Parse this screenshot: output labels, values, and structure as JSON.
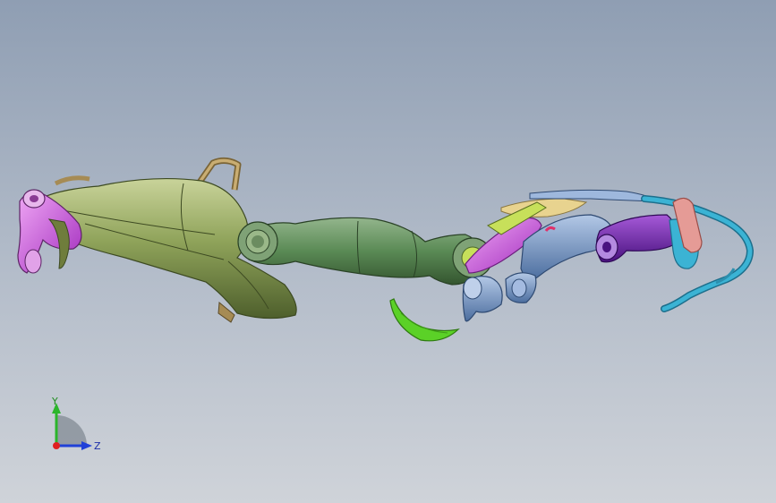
{
  "viewport": {
    "background_top": "#8f9eb3",
    "background_bottom": "#cfd3d9"
  },
  "model": {
    "parts": [
      {
        "name": "palm-cover",
        "color": "#8fa35a"
      },
      {
        "name": "finger-joint-purple",
        "color": "#c163c9"
      },
      {
        "name": "handle-loop",
        "color": "#a68b54"
      },
      {
        "name": "forearm-link",
        "color": "#5a8a55"
      },
      {
        "name": "finger-segment-magenta",
        "color": "#c24cd8"
      },
      {
        "name": "finger-segment-blue",
        "color": "#6f92c4"
      },
      {
        "name": "finger-segment-violet",
        "color": "#7a2ab8"
      },
      {
        "name": "cable-cyan",
        "color": "#3bb3d4"
      },
      {
        "name": "clip-pink",
        "color": "#e59b96"
      },
      {
        "name": "plate-tan",
        "color": "#e8d38f"
      },
      {
        "name": "shell-green",
        "color": "#5bd127"
      }
    ]
  },
  "triad": {
    "y_label": "Y",
    "z_label": "Z",
    "x_color": "#e02020",
    "y_color": "#2bb52b",
    "z_color": "#2040d8"
  }
}
